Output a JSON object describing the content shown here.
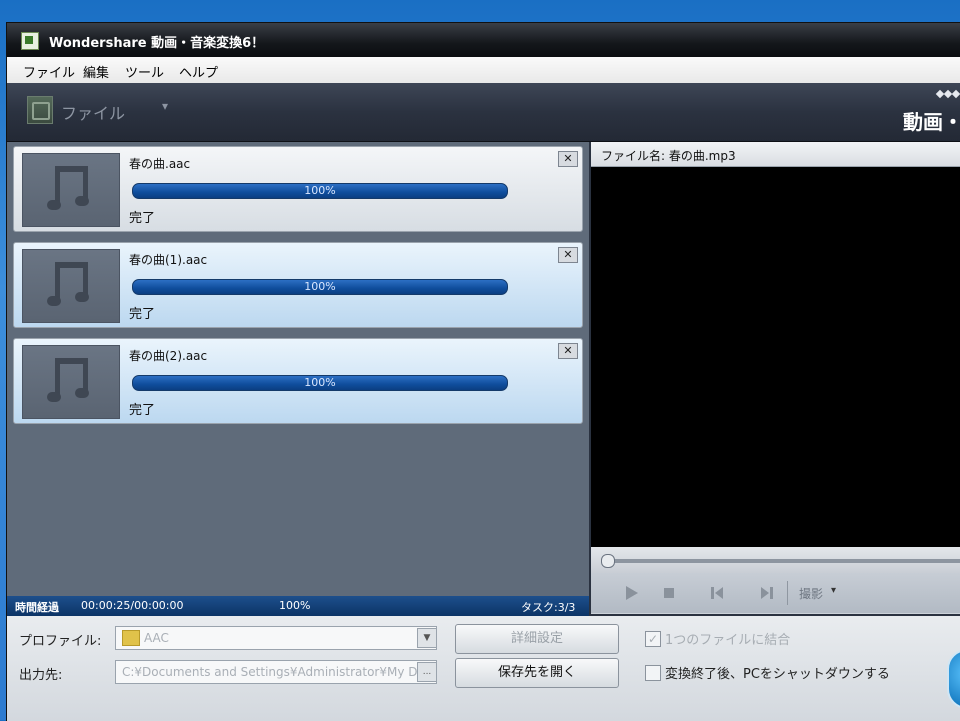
{
  "window": {
    "title": "Wondershare 動画・音楽変換6！"
  },
  "menu": [
    "ファイル",
    "編集",
    "ツール",
    "ヘルプ"
  ],
  "toolbar": {
    "file_label": "ファイル",
    "dropdown_glyph": "▾",
    "brand_label": "動画・"
  },
  "items": [
    {
      "filename": "春の曲.aac",
      "progress": 100,
      "progress_text": "100%",
      "status": "完了"
    },
    {
      "filename": "春の曲(1).aac",
      "progress": 100,
      "progress_text": "100%",
      "status": "完了"
    },
    {
      "filename": "春の曲(2).aac",
      "progress": 100,
      "progress_text": "100%",
      "status": "完了"
    }
  ],
  "statusbar": {
    "elapsed_label": "時間経過",
    "elapsed": "00:00:25/00:00:00",
    "total_progress": "100%",
    "task": "タスク:3/3"
  },
  "preview": {
    "filename_label": "ファイル名: 春の曲.mp3"
  },
  "bottom": {
    "profile_label": "プロファイル:",
    "profile_value": "AAC",
    "output_label": "出力先:",
    "output_value": "C:¥Documents and Settings¥Administrator¥My Do",
    "detail_button": "詳細設定",
    "open_folder_button": "保存先を開く",
    "merge_label": "1つのファイルに結合",
    "shutdown_label": "変換終了後、PCをシャットダウンする",
    "output_browse": "..."
  },
  "controls": {
    "snapshot_label": "撮影"
  },
  "colors": {
    "progress_blue": "#0f4d9c",
    "preview_bg": "#000000",
    "status_bar": "#0c3466"
  }
}
